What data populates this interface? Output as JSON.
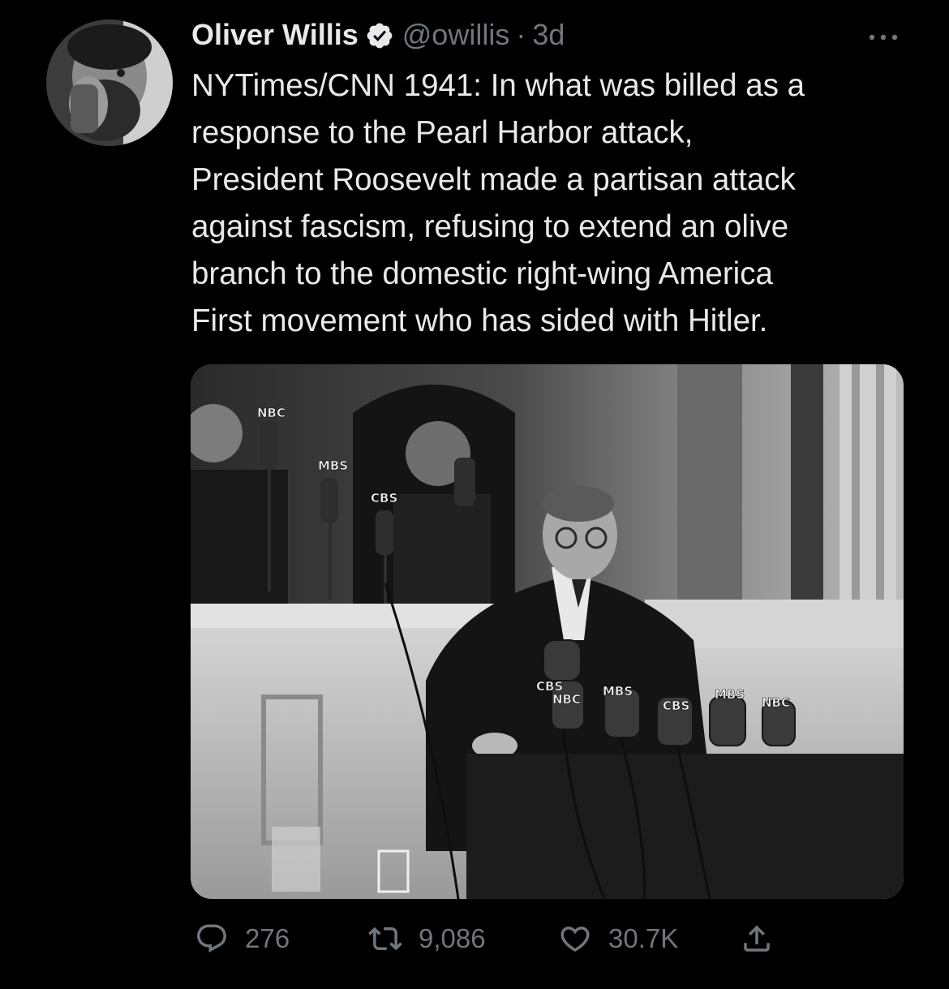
{
  "tweet": {
    "author": {
      "display_name": "Oliver Willis",
      "handle": "@owillis",
      "verified": true
    },
    "separator": "·",
    "time_ago": "3d",
    "text": "NYTimes/CNN 1941: In what was billed as a\nresponse to the Pearl Harbor attack,\nPresident Roosevelt made a partisan attack\nagainst fascism, refusing to extend an olive\nbranch to the domestic right-wing America\nFirst movement who has sided with Hitler.",
    "media": {
      "mic_labels": [
        "NBC",
        "MBS",
        "CBS",
        "CBS",
        "NBC",
        "MBS",
        "CBS",
        "MBS",
        "NBC"
      ]
    },
    "actions": {
      "replies": "276",
      "retweets": "9,086",
      "likes": "30.7K"
    }
  },
  "colors": {
    "background": "#000000",
    "text_primary": "#e7e9ea",
    "text_secondary": "#71767b",
    "verified_badge": "#e7e9ea"
  },
  "icons": {
    "verified": "verified-badge-icon",
    "more": "more-icon",
    "reply": "reply-icon",
    "retweet": "retweet-icon",
    "like": "heart-icon",
    "share": "share-icon"
  }
}
